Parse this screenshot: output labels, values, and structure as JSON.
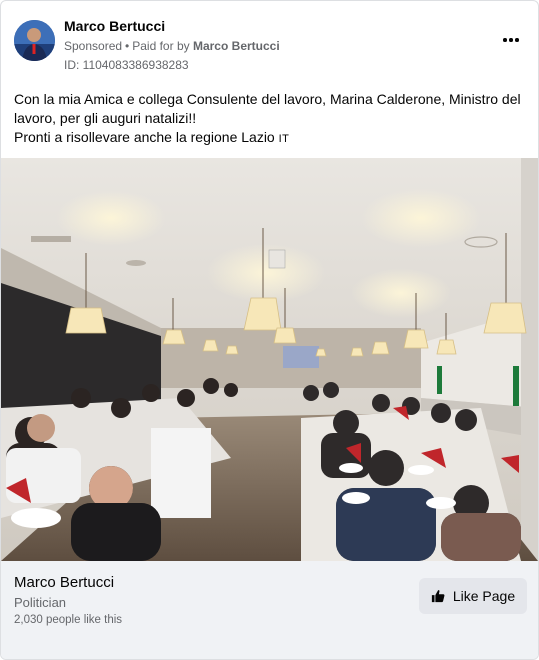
{
  "post": {
    "author": "Marco Bertucci",
    "sponsored_label": "Sponsored",
    "separator": "•",
    "paid_for_label": "Paid for by",
    "paid_for_name": "Marco Bertucci",
    "ad_id": "ID: 1104083386938283",
    "text_line1": "Con la mia Amica e collega Consulente del lavoro, Marina Calderone, Ministro del lavoro, per gli auguri natalizi!!",
    "text_line2": "Pronti a risollevare anche la regione Lazio",
    "flag_text": "IT",
    "more_icon": "more-horizontal-icon"
  },
  "page": {
    "name": "Marco Bertucci",
    "category": "Politician",
    "likes": "2,030 people like this",
    "like_button": "Like Page",
    "like_icon": "thumbs-up-icon"
  },
  "colors": {
    "secondary_text": "#65676b",
    "footer_bg": "#f0f2f5",
    "button_bg": "#e4e6eb"
  }
}
